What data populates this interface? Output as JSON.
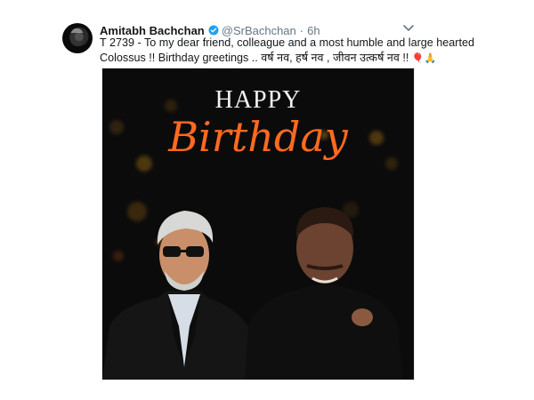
{
  "author": {
    "name": "Amitabh Bachchan",
    "handle": "@SrBachchan",
    "separator": "·",
    "time": "6h"
  },
  "tweet": {
    "line1": "T 2739 - To my dear friend, colleague and a most humble and large hearted",
    "line2": "Colossus !! Birthday greetings .. वर्ष नव, हर्ष नव , जीवन उत्कर्ष नव !! ",
    "emoji": "🎈🙏"
  },
  "image": {
    "title_top": "HAPPY",
    "title_script": "Birthday"
  },
  "icons": {
    "verified": "verified-badge-icon",
    "menu": "chevron-down-icon"
  },
  "colors": {
    "name": "#14171a",
    "meta": "#657786",
    "verified": "#1da1f2",
    "accent": "#ff6a1f"
  }
}
